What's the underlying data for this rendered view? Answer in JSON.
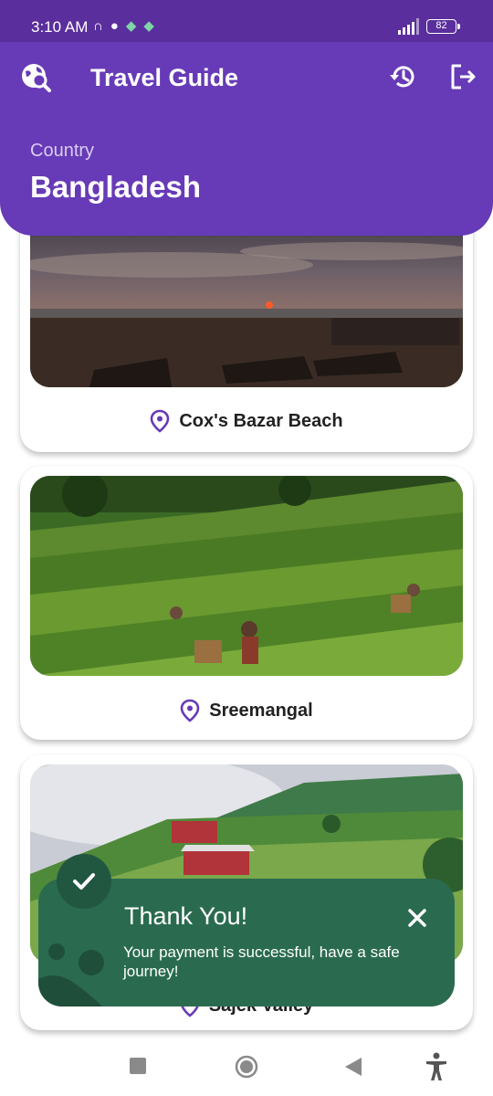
{
  "status_bar": {
    "time": "3:10 AM",
    "battery": "82",
    "icons": [
      "headphones-icon",
      "ring-icon",
      "app-icon",
      "app-icon"
    ]
  },
  "header": {
    "title": "Travel Guide",
    "country_label": "Country",
    "country_name": "Bangladesh",
    "logo_icon": "globe-search-icon",
    "actions": [
      "history-icon",
      "logout-icon"
    ],
    "background_color": "#673ab7"
  },
  "destinations": [
    {
      "name": "Cox's Bazar Beach",
      "image": "beach-sunset-photo"
    },
    {
      "name": "Sreemangal",
      "image": "tea-garden-photo"
    },
    {
      "name": "Sajek Valley",
      "image": "hill-valley-photo"
    }
  ],
  "toast": {
    "title": "Thank You!",
    "message": "Your payment is successful, have a safe journey!",
    "background_color": "#2a6b4f",
    "icon": "check-icon",
    "close_icon": "close-icon"
  },
  "nav_bar": {
    "buttons": [
      "recents-button",
      "home-button",
      "back-button",
      "accessibility-button"
    ]
  }
}
